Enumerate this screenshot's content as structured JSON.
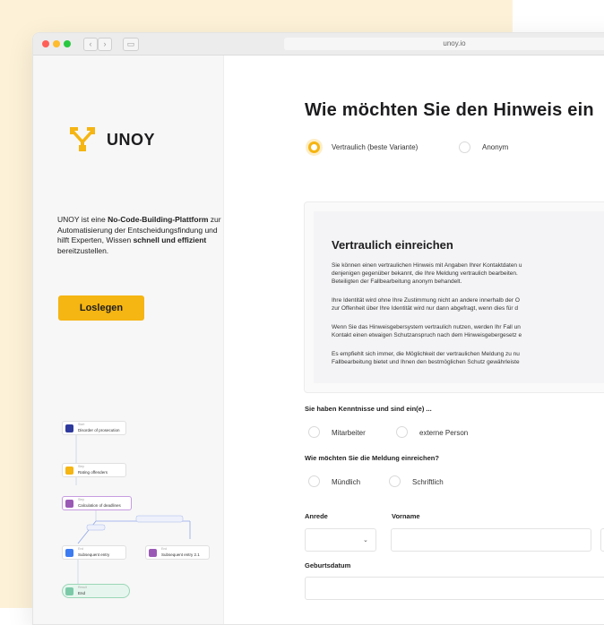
{
  "browser": {
    "url": "unoy.io"
  },
  "sidebar": {
    "brand": "UNOY",
    "description": {
      "part1": "UNOY ist eine ",
      "bold1": "No-Code-Building-Plattform",
      "part2": " zur Automatisierung der Entscheidungsfindung und hilft Experten, Wissen ",
      "bold2": "schnell und effizient",
      "part3": " bereitzustellen."
    },
    "cta_label": "Loslegen",
    "flow_nodes": [
      {
        "sub": "Start",
        "label": "Disorder of prosecution",
        "color": "#2f3b9c"
      },
      {
        "sub": "Step",
        "label": "Rating offenders",
        "color": "#f5b512"
      },
      {
        "sub": "Step",
        "label": "Calculation of deadlines",
        "color": "#9b59b6"
      },
      {
        "sub": "End",
        "label": "Subsequent entry",
        "color": "#3d7cf0"
      },
      {
        "sub": "End",
        "label": "Subsequent entry 2.1",
        "color": "#9b59b6"
      },
      {
        "sub": "Result",
        "label": "End",
        "color": "#7cc9a8"
      }
    ]
  },
  "main": {
    "title": "Wie möchten Sie den Hinweis ein",
    "options": [
      "Vertraulich (beste Variante)",
      "Anonym"
    ],
    "panel": {
      "heading": "Vertraulich einreichen",
      "paragraphs": [
        [
          "Sie können einen vertraulichen Hinweis mit Angaben Ihrer Kontaktdaten u",
          "denjenigen gegenüber bekannt, die Ihre Meldung vertraulich bearbeiten.",
          "Beteiligten der Fallbearbeitung anonym behandelt."
        ],
        [
          "Ihre Identität wird ohne Ihre Zustimmung nicht an andere innerhalb der O",
          "zur Offenheit über Ihre Identität wird nur dann abgefragt, wenn dies für d"
        ],
        [
          "Wenn Sie das Hinweisgebersystem vertraulich nutzen, werden Ihr Fall un",
          "Kontakt einen etwaigen Schutzanspruch nach dem Hinweisgebergesetz e"
        ],
        [
          "Es empfiehlt sich immer, die Möglichkeit der vertraulichen Meldung zu nu",
          "Fallbearbeitung bietet und Ihnen den bestmöglichen Schutz gewährleiste"
        ]
      ]
    },
    "question1": "Sie haben Kenntnisse und sind ein(e) ...",
    "q1_options": [
      "Mitarbeiter",
      "externe Person"
    ],
    "question2": "Wie möchten Sie die Meldung einreichen?",
    "q2_options": [
      "Mündlich",
      "Schriftlich"
    ],
    "label_anrede": "Anrede",
    "label_vorname": "Vorname",
    "label_geburtsdatum": "Geburtsdatum"
  },
  "colors": {
    "accent": "#f5b512",
    "cream": "#fdf2d8"
  }
}
